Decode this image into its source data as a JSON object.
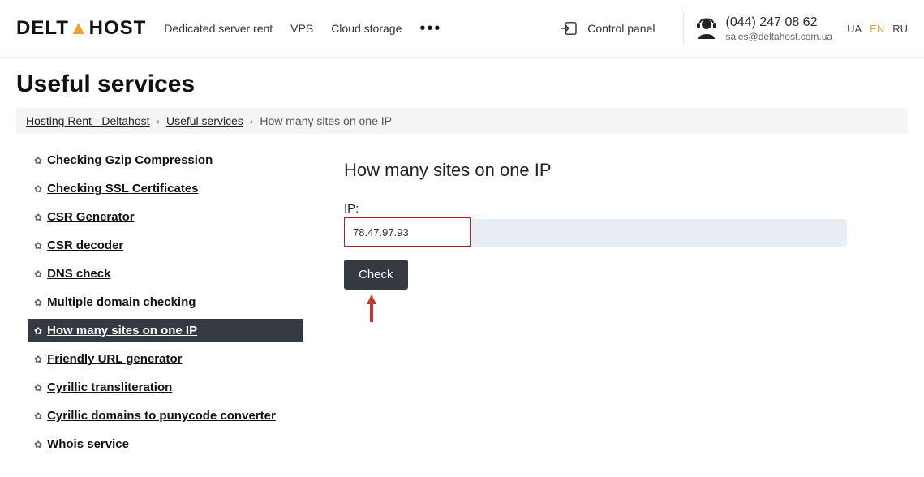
{
  "header": {
    "logo_left": "DELT",
    "logo_tri": "▲",
    "logo_right": "HOST",
    "nav": [
      {
        "label": "Dedicated server rent"
      },
      {
        "label": "VPS"
      },
      {
        "label": "Cloud storage"
      }
    ],
    "control_panel": "Control panel",
    "phone": "(044) 247 08 62",
    "email": "sales@deltahost.com.ua",
    "langs": [
      {
        "code": "UA",
        "active": false
      },
      {
        "code": "EN",
        "active": true
      },
      {
        "code": "RU",
        "active": false
      }
    ]
  },
  "page_title": "Useful services",
  "breadcrumb": {
    "a": "Hosting Rent - Deltahost",
    "b": "Useful services",
    "current": "How many sites on one IP",
    "sep": "›"
  },
  "sidebar": {
    "items": [
      {
        "label": "Checking Gzip Compression",
        "active": false
      },
      {
        "label": "Checking SSL Certificates",
        "active": false
      },
      {
        "label": "CSR Generator",
        "active": false
      },
      {
        "label": "CSR decoder",
        "active": false
      },
      {
        "label": "DNS check",
        "active": false
      },
      {
        "label": "Multiple domain checking",
        "active": false
      },
      {
        "label": "How many sites on one IP",
        "active": true
      },
      {
        "label": "Friendly URL generator",
        "active": false
      },
      {
        "label": "Cyrillic transliteration",
        "active": false
      },
      {
        "label": "Cyrillic domains to punycode converter",
        "active": false
      },
      {
        "label": "Whois service",
        "active": false
      }
    ]
  },
  "tool": {
    "title": "How many sites on one IP",
    "ip_label": "IP:",
    "ip_value": "78.47.97.93",
    "check_label": "Check"
  }
}
